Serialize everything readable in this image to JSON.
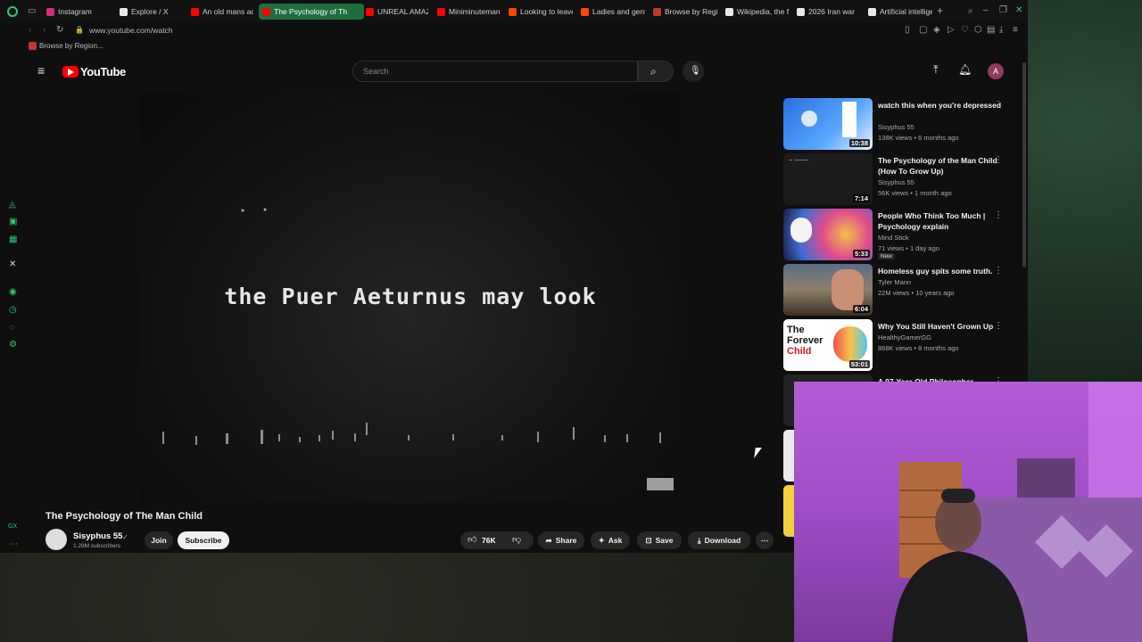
{
  "browser": {
    "tabs": [
      {
        "label": "Instagram",
        "color": "#d62976"
      },
      {
        "label": "Explore / X",
        "color": "#e8e8e8"
      },
      {
        "label": "An old mans ad",
        "color": "#ff0000"
      },
      {
        "label": "The Psychology of Th",
        "color": "#ff0000",
        "active": true
      },
      {
        "label": "UNREAL AMAZI",
        "color": "#ff0000"
      },
      {
        "label": "Miniminuteman",
        "color": "#ff0000"
      },
      {
        "label": "Looking to leave",
        "color": "#ff4500"
      },
      {
        "label": "Ladies and gent",
        "color": "#ff4500"
      },
      {
        "label": "Browse by Regi",
        "color": "#c0392b"
      },
      {
        "label": "Wikipedia, the f",
        "color": "#e8e8e8"
      },
      {
        "label": "2026 Iran war",
        "color": "#e8e8e8"
      },
      {
        "label": "Artificial intellige",
        "color": "#e8e8e8"
      }
    ],
    "new_tab_icon": "plus-icon",
    "url": "www.youtube.com/watch",
    "bookmark": "Browse by Region..."
  },
  "youtube": {
    "logo_text": "YouTube",
    "search_placeholder": "Search",
    "avatar_letter": "A",
    "video_caption": "the Puer Aeturnus may look",
    "title": "The Psychology of The Man Child",
    "channel": "Sisyphus 55",
    "subscribers": "1.29M subscribers",
    "join": "Join",
    "subscribe": "Subscribe",
    "likes": "76K",
    "share": "Share",
    "ask": "Ask",
    "save": "Save",
    "download": "Download",
    "accent": "#ff0000"
  },
  "related": [
    {
      "title": "watch this when you're depressed",
      "channel": "Sisyphus 55",
      "meta": "138K views • 6 months ago",
      "duration": "10:38"
    },
    {
      "title": "The Psychology of the Man Child (How To Grow Up)",
      "channel": "Sisyphus 55",
      "meta": "56K views • 1 month ago",
      "duration": "7:14"
    },
    {
      "title": "People Who Think Too Much | Psychology explain",
      "channel": "Mind Stick",
      "meta": "71 views • 1 day ago",
      "duration": "5:33",
      "badge": "New"
    },
    {
      "title": "Homeless guy spits some truth.",
      "channel": "Tyler Mann",
      "meta": "22M views • 10 years ago",
      "duration": "6:04"
    },
    {
      "title": "Why You Still Haven't Grown Up",
      "channel": "HealthyGamerGG",
      "meta": "868K views • 8 months ago",
      "duration": "53:01",
      "thumb_text_1": "The",
      "thumb_text_2": "Forever",
      "thumb_text_3": "Child"
    },
    {
      "title": "A 97-Year-Old Philosopher",
      "channel": "",
      "meta": "",
      "duration": ""
    }
  ]
}
